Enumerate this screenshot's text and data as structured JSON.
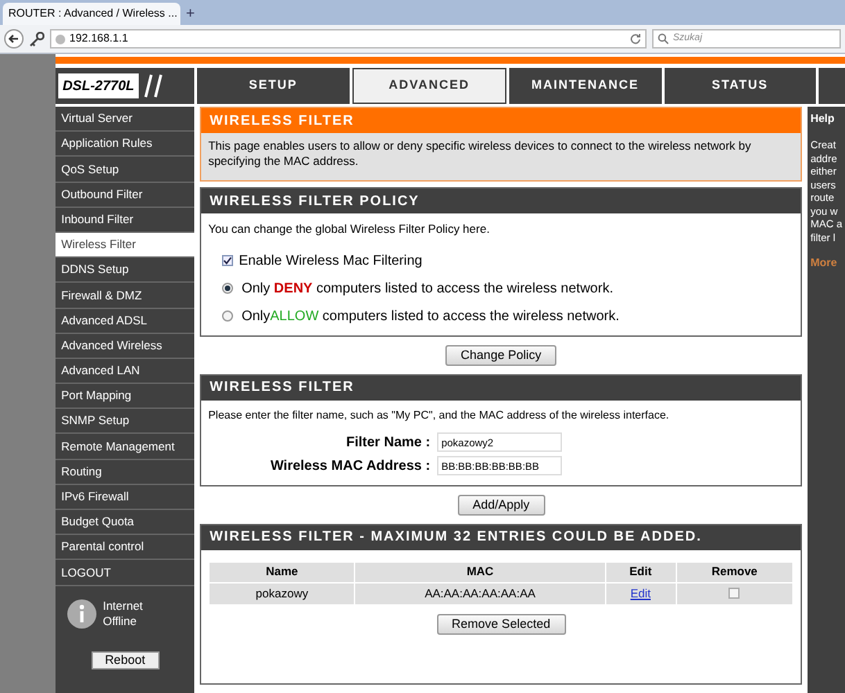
{
  "browser": {
    "tab_title": "ROUTER : Advanced / Wireless ...",
    "new_tab": "+",
    "url": "192.168.1.1",
    "search_placeholder": "Szukaj"
  },
  "logo": "DSL-2770L",
  "top_tabs": [
    {
      "label": "SETUP",
      "selected": false
    },
    {
      "label": "ADVANCED",
      "selected": true
    },
    {
      "label": "MAINTENANCE",
      "selected": false
    },
    {
      "label": "STATUS",
      "selected": false
    }
  ],
  "sidebar": {
    "items": [
      {
        "label": "Virtual Server",
        "selected": false
      },
      {
        "label": "Application Rules",
        "selected": false
      },
      {
        "label": "QoS Setup",
        "selected": false
      },
      {
        "label": "Outbound Filter",
        "selected": false
      },
      {
        "label": "Inbound Filter",
        "selected": false
      },
      {
        "label": "Wireless Filter",
        "selected": true
      },
      {
        "label": "DDNS Setup",
        "selected": false
      },
      {
        "label": "Firewall & DMZ",
        "selected": false
      },
      {
        "label": "Advanced ADSL",
        "selected": false
      },
      {
        "label": "Advanced Wireless",
        "selected": false
      },
      {
        "label": "Advanced LAN",
        "selected": false
      },
      {
        "label": "Port Mapping",
        "selected": false
      },
      {
        "label": "SNMP Setup",
        "selected": false
      },
      {
        "label": "Remote Management",
        "selected": false
      },
      {
        "label": "Routing",
        "selected": false
      },
      {
        "label": "IPv6 Firewall",
        "selected": false
      },
      {
        "label": "Budget Quota",
        "selected": false
      },
      {
        "label": "Parental control",
        "selected": false
      },
      {
        "label": "LOGOUT",
        "selected": false
      }
    ],
    "status": [
      "Internet",
      "Offline"
    ],
    "reboot": "Reboot"
  },
  "intro": {
    "title": "WIRELESS FILTER",
    "text": "This page enables users to allow or deny specific wireless devices to connect to the wireless network by specifying the MAC address."
  },
  "policy": {
    "title": "WIRELESS FILTER POLICY",
    "text": "You can change the global Wireless Filter Policy here.",
    "enable": {
      "label": "Enable Wireless Mac Filtering",
      "checked": true
    },
    "options": [
      {
        "prefix": "Only ",
        "highlight": "DENY",
        "suffix": " computers listed to access the wireless network.",
        "color": "#cc0000",
        "selected": true
      },
      {
        "prefix": "Only",
        "highlight": "ALLOW",
        "suffix": " computers listed to access the wireless network.",
        "color": "#22aa22",
        "selected": false
      }
    ],
    "button": "Change Policy"
  },
  "filter": {
    "title": "WIRELESS FILTER",
    "text": "Please enter the filter name, such as \"My PC\", and the MAC address of the wireless interface.",
    "fields": [
      {
        "label": "Filter Name :",
        "value": "pokazowy2"
      },
      {
        "label": "Wireless MAC Address :",
        "value": "BB:BB:BB:BB:BB:BB"
      }
    ],
    "button": "Add/Apply"
  },
  "list": {
    "title": "WIRELESS FILTER - MAXIMUM 32 ENTRIES COULD BE ADDED.",
    "columns": [
      "Name",
      "MAC",
      "Edit",
      "Remove"
    ],
    "rows": [
      {
        "name": "pokazowy",
        "mac": "AA:AA:AA:AA:AA:AA",
        "edit": "Edit",
        "remove": false
      }
    ],
    "button": "Remove Selected"
  },
  "help": {
    "title": "Help",
    "lines": [
      "Creat",
      "addre",
      "either",
      "users",
      "route",
      "you w",
      "MAC a",
      "filter l"
    ],
    "more": "More"
  }
}
